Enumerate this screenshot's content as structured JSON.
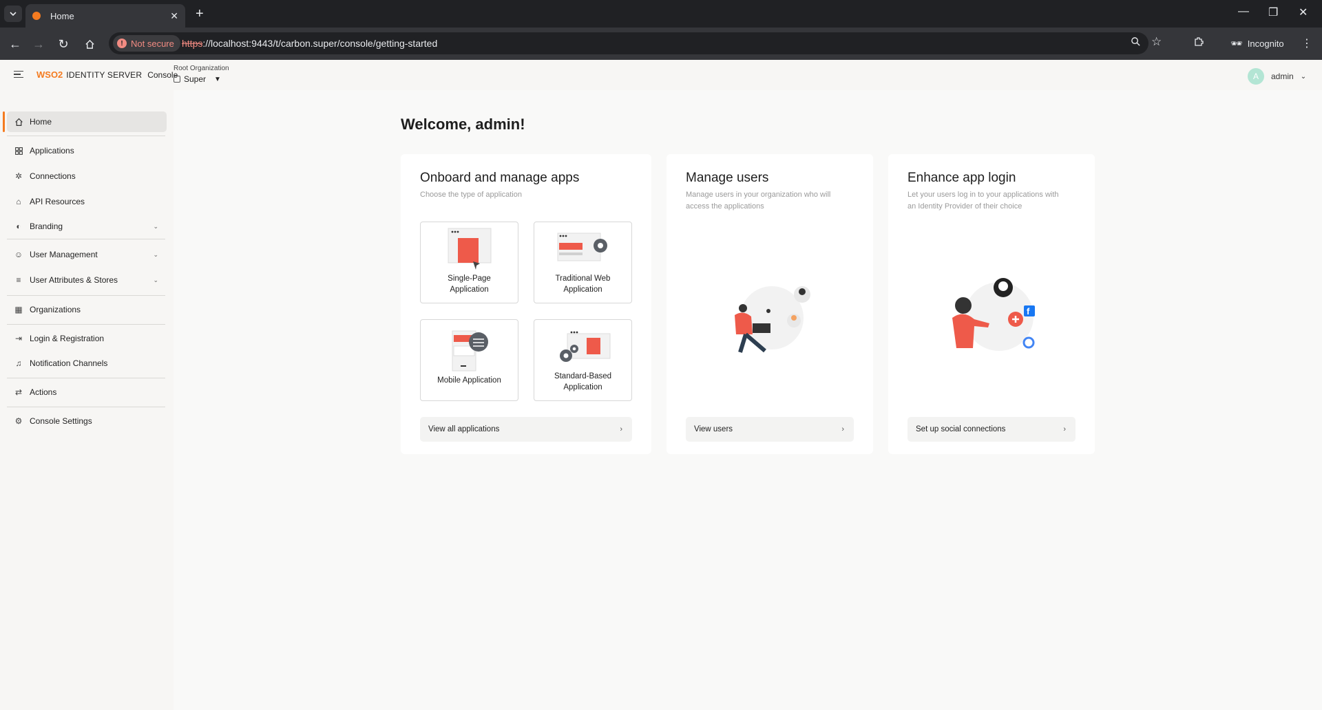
{
  "browser": {
    "tab_title": "Home",
    "new_tab_symbol": "+",
    "security_chip": "Not secure",
    "url_scheme": "https",
    "url_rest": "://localhost:9443/t/carbon.super/console/getting-started",
    "incognito_label": "Incognito"
  },
  "header": {
    "logo_brand": "WSO2",
    "logo_product": "IDENTITY SERVER",
    "console_label": "Console",
    "org_label": "Root Organization",
    "org_value": "Super",
    "user_initial": "A",
    "user_name": "admin"
  },
  "sidebar": {
    "items": [
      {
        "label": "Home",
        "icon": "home-icon"
      },
      {
        "label": "Applications",
        "icon": "grid-icon"
      },
      {
        "label": "Connections",
        "icon": "connections-icon"
      },
      {
        "label": "API Resources",
        "icon": "api-icon"
      },
      {
        "label": "Branding",
        "icon": "palette-icon"
      },
      {
        "label": "User Management",
        "icon": "users-icon"
      },
      {
        "label": "User Attributes & Stores",
        "icon": "attributes-icon"
      },
      {
        "label": "Organizations",
        "icon": "building-icon"
      },
      {
        "label": "Login & Registration",
        "icon": "login-icon"
      },
      {
        "label": "Notification Channels",
        "icon": "bell-icon"
      },
      {
        "label": "Actions",
        "icon": "actions-icon"
      },
      {
        "label": "Console Settings",
        "icon": "gear-icon"
      }
    ]
  },
  "main": {
    "welcome": "Welcome, admin!",
    "cards": [
      {
        "title": "Onboard and manage apps",
        "subtitle": "Choose the type of application",
        "cta": "View all applications",
        "tiles": [
          {
            "label_1": "Single-Page",
            "label_2": "Application"
          },
          {
            "label_1": "Traditional Web",
            "label_2": "Application"
          },
          {
            "label_1": "Mobile Application",
            "label_2": ""
          },
          {
            "label_1": "Standard-Based",
            "label_2": "Application"
          }
        ]
      },
      {
        "title": "Manage users",
        "subtitle_1": "Manage users in your organization who will",
        "subtitle_2": "access the applications",
        "cta": "View users"
      },
      {
        "title": "Enhance app login",
        "subtitle_1": "Let your users log in to your applications with",
        "subtitle_2": "an Identity Provider of their choice",
        "cta": "Set up social connections"
      }
    ]
  },
  "colors": {
    "accent": "#f47b20",
    "illustration_red": "#ee5a4a"
  }
}
